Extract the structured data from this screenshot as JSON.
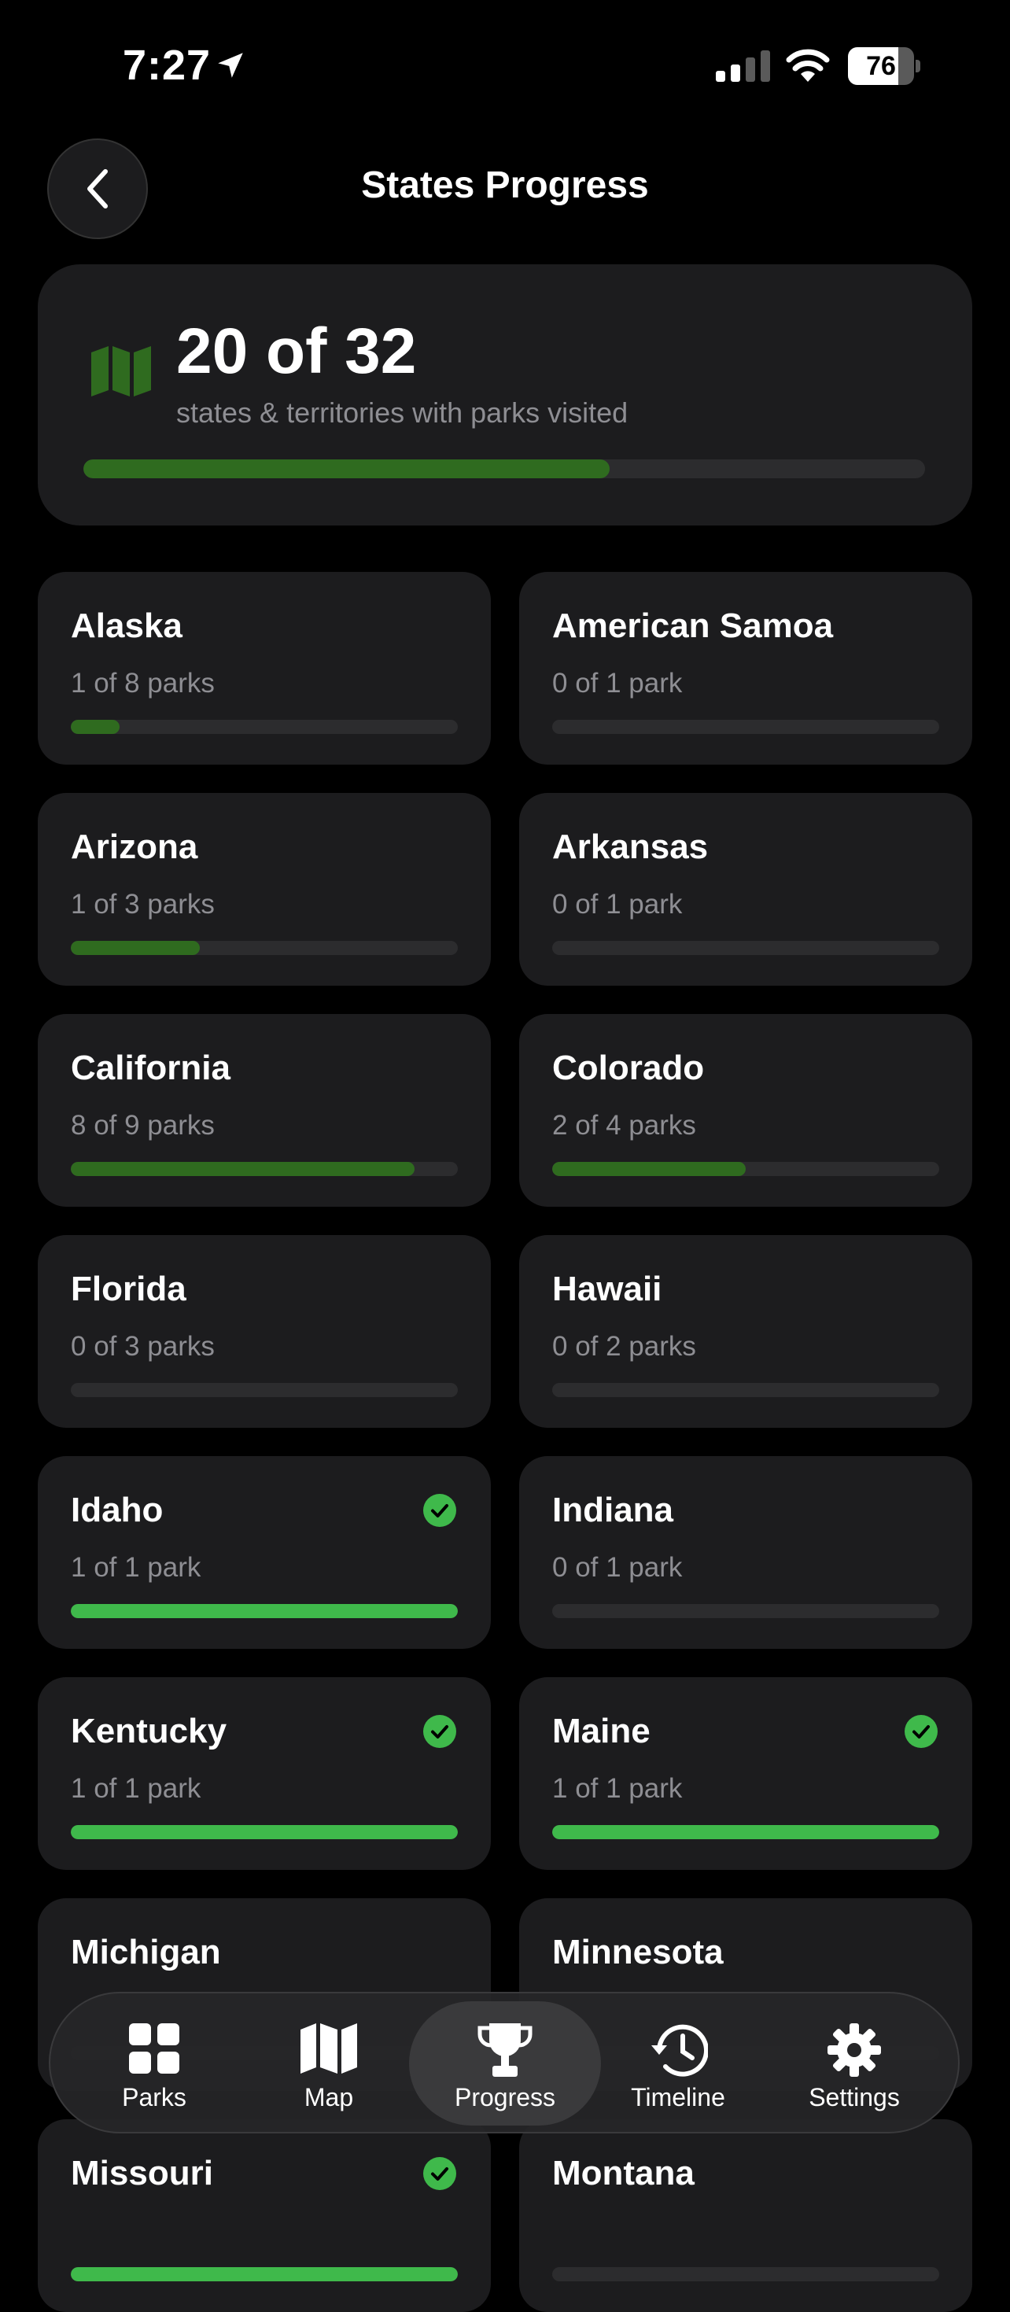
{
  "status_bar": {
    "time": "7:27",
    "battery": "76",
    "battery_level": 0.76
  },
  "header": {
    "title": "States Progress"
  },
  "summary": {
    "count": "20 of 32",
    "label": "states & territories with parks visited",
    "progress": 0.625
  },
  "states": [
    {
      "name": "Alaska",
      "sub": "1 of 8 parks",
      "progress": 0.125,
      "complete": false
    },
    {
      "name": "American Samoa",
      "sub": "0 of 1 park",
      "progress": 0,
      "complete": false
    },
    {
      "name": "Arizona",
      "sub": "1 of 3 parks",
      "progress": 0.333,
      "complete": false
    },
    {
      "name": "Arkansas",
      "sub": "0 of 1 park",
      "progress": 0,
      "complete": false
    },
    {
      "name": "California",
      "sub": "8 of 9 parks",
      "progress": 0.889,
      "complete": false
    },
    {
      "name": "Colorado",
      "sub": "2 of 4 parks",
      "progress": 0.5,
      "complete": false
    },
    {
      "name": "Florida",
      "sub": "0 of 3 parks",
      "progress": 0,
      "complete": false
    },
    {
      "name": "Hawaii",
      "sub": "0 of 2 parks",
      "progress": 0,
      "complete": false
    },
    {
      "name": "Idaho",
      "sub": "1 of 1 park",
      "progress": 1,
      "complete": true
    },
    {
      "name": "Indiana",
      "sub": "0 of 1 park",
      "progress": 0,
      "complete": false
    },
    {
      "name": "Kentucky",
      "sub": "1 of 1 park",
      "progress": 1,
      "complete": true
    },
    {
      "name": "Maine",
      "sub": "1 of 1 park",
      "progress": 1,
      "complete": true
    },
    {
      "name": "Michigan",
      "sub": "",
      "progress": 0,
      "complete": false
    },
    {
      "name": "Minnesota",
      "sub": "",
      "progress": 0,
      "complete": false
    },
    {
      "name": "Missouri",
      "sub": "",
      "progress": 1,
      "complete": true
    },
    {
      "name": "Montana",
      "sub": "",
      "progress": 0,
      "complete": false
    }
  ],
  "tabs": [
    {
      "label": "Parks",
      "icon": "grid-icon",
      "active": false
    },
    {
      "label": "Map",
      "icon": "map-icon",
      "active": false
    },
    {
      "label": "Progress",
      "icon": "trophy-icon",
      "active": true
    },
    {
      "label": "Timeline",
      "icon": "history-icon",
      "active": false
    },
    {
      "label": "Settings",
      "icon": "gear-icon",
      "active": false
    }
  ],
  "colors": {
    "progress_partial": "#2f6b1f",
    "progress_complete": "#3fb94b",
    "card": "#1c1c1e"
  }
}
